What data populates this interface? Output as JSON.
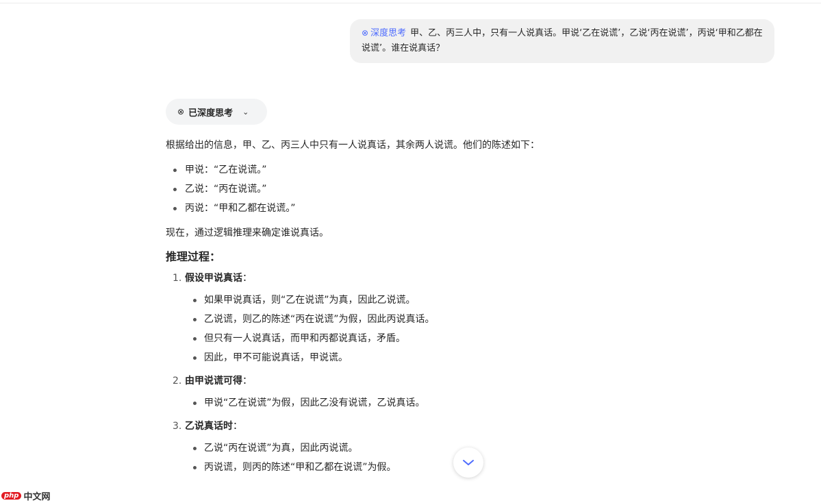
{
  "user_message": {
    "tag_label": "深度思考",
    "tag_icon": "deep-think-icon",
    "text": "甲、乙、丙三人中，只有一人说真话。甲说‘乙在说谎’，乙说‘丙在说谎’，丙说‘甲和乙都在说谎’。谁在说真话？"
  },
  "thinking_toggle": {
    "label": "已深度思考",
    "icon": "deep-think-icon"
  },
  "answer": {
    "intro": "根据给出的信息，甲、乙、丙三人中只有一人说真话，其余两人说谎。他们的陈述如下：",
    "statements": [
      "甲说：“乙在说谎。”",
      "乙说：“丙在说谎。”",
      "丙说：“甲和乙都在说谎。”"
    ],
    "transition": "现在，通过逻辑推理来确定谁说真话。",
    "section_title": "推理过程：",
    "steps": [
      {
        "num": "1.",
        "title": "假设甲说真话",
        "suffix": "：",
        "points": [
          "如果甲说真话，则“乙在说谎”为真，因此乙说谎。",
          "乙说谎，则乙的陈述“丙在说谎”为假，因此丙说真话。",
          "但只有一人说真话，而甲和丙都说真话，矛盾。",
          "因此，甲不可能说真话，甲说谎。"
        ]
      },
      {
        "num": "2.",
        "title": "由甲说谎可得",
        "suffix": "：",
        "points": [
          "甲说“乙在说谎”为假，因此乙没有说谎，乙说真话。"
        ]
      },
      {
        "num": "3.",
        "title": "乙说真话时",
        "suffix": "：",
        "points": [
          "乙说“丙在说谎”为真，因此丙说谎。",
          "丙说谎，则丙的陈述“甲和乙都在说谎”为假。"
        ]
      }
    ]
  },
  "scroll_button_icon": "chevron-down-icon",
  "watermark": {
    "badge": "php",
    "text": "中文网"
  },
  "colors": {
    "accent": "#4d6bfe",
    "bubble": "#f1f1f1",
    "pill": "#f3f4f5"
  }
}
